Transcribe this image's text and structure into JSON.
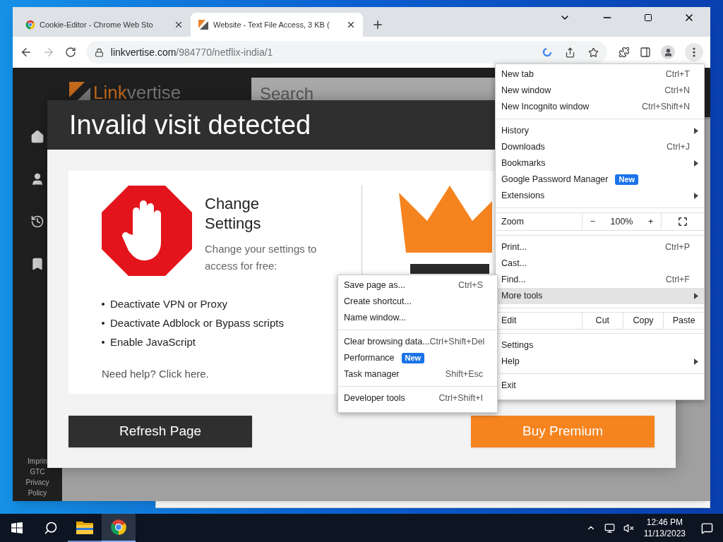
{
  "browser": {
    "tabs": [
      {
        "title": "Cookie-Editor - Chrome Web Sto",
        "selected": false
      },
      {
        "title": "Website - Text File Access, 3 KB (",
        "selected": true
      }
    ],
    "url_host": "linkvertise.com",
    "url_path": "/984770/netflix-india/1"
  },
  "site": {
    "logo_lead": "Link",
    "logo_rest": "vertise",
    "search_placeholder": "Search",
    "footer_links": [
      "Imprin",
      "GTC",
      "Privacy Policy"
    ]
  },
  "modal": {
    "title": "Invalid visit detected",
    "heading": "Change Settings",
    "subtext": "Change your settings to access for free:",
    "steps": [
      "Deactivate VPN or Proxy",
      "Deactivate Adblock or Bypass scripts",
      "Enable JavaScript"
    ],
    "help": "Need help? Click here.",
    "buttons": [
      {
        "label": "Refresh Page",
        "kind": "secondary"
      },
      {
        "label": "Buy Premium",
        "kind": "primary"
      }
    ]
  },
  "chrome_menu": {
    "sections": [
      [
        {
          "kind": "item",
          "label": "New tab",
          "shortcut": "Ctrl+T",
          "submenu": false,
          "selected": false
        },
        {
          "kind": "item",
          "label": "New window",
          "shortcut": "Ctrl+N",
          "submenu": false,
          "selected": false
        },
        {
          "kind": "item",
          "label": "New Incognito window",
          "shortcut": "Ctrl+Shift+N",
          "submenu": false,
          "selected": false
        }
      ],
      [
        {
          "kind": "item",
          "label": "History",
          "submenu": true,
          "selected": false
        },
        {
          "kind": "item",
          "label": "Downloads",
          "shortcut": "Ctrl+J",
          "submenu": false,
          "selected": false
        },
        {
          "kind": "item",
          "label": "Bookmarks",
          "submenu": true,
          "selected": false
        },
        {
          "kind": "item",
          "label": "Google Password Manager",
          "badge": "New",
          "submenu": false,
          "selected": false
        },
        {
          "kind": "item",
          "label": "Extensions",
          "submenu": true,
          "selected": false
        }
      ],
      [
        {
          "kind": "zoom",
          "label": "Zoom",
          "minus": "−",
          "value": "100%",
          "plus": "+"
        }
      ],
      [
        {
          "kind": "item",
          "label": "Print...",
          "shortcut": "Ctrl+P",
          "submenu": false,
          "selected": false
        },
        {
          "kind": "item",
          "label": "Cast...",
          "submenu": false,
          "selected": false
        },
        {
          "kind": "item",
          "label": "Find...",
          "shortcut": "Ctrl+F",
          "submenu": false,
          "selected": false
        },
        {
          "kind": "item",
          "label": "More tools",
          "submenu": true,
          "selected": true
        }
      ],
      [
        {
          "kind": "edit",
          "label": "Edit",
          "actions": [
            "Cut",
            "Copy",
            "Paste"
          ]
        }
      ],
      [
        {
          "kind": "item",
          "label": "Settings",
          "submenu": false,
          "selected": false
        },
        {
          "kind": "item",
          "label": "Help",
          "submenu": true,
          "selected": false
        }
      ],
      [
        {
          "kind": "item",
          "label": "Exit",
          "submenu": false,
          "selected": false
        }
      ]
    ]
  },
  "more_tools_menu": {
    "sections": [
      [
        {
          "kind": "item",
          "label": "Save page as...",
          "shortcut": "Ctrl+S",
          "submenu": false,
          "selected": false
        },
        {
          "kind": "item",
          "label": "Create shortcut...",
          "submenu": false,
          "selected": false
        },
        {
          "kind": "item",
          "label": "Name window...",
          "submenu": false,
          "selected": false
        }
      ],
      [
        {
          "kind": "item",
          "label": "Clear browsing data...",
          "shortcut": "Ctrl+Shift+Del",
          "submenu": false,
          "selected": false
        },
        {
          "kind": "item",
          "label": "Performance",
          "badge": "New",
          "submenu": false,
          "selected": false
        },
        {
          "kind": "item",
          "label": "Task manager",
          "shortcut": "Shift+Esc",
          "submenu": false,
          "selected": false
        }
      ],
      [
        {
          "kind": "item",
          "label": "Developer tools",
          "shortcut": "Ctrl+Shift+I",
          "submenu": false,
          "selected": false
        }
      ]
    ]
  },
  "taskbar": {
    "apps": [
      {
        "kind": "explorer",
        "selected": false
      },
      {
        "kind": "chrome",
        "selected": true
      }
    ],
    "time": "12:46 PM",
    "date": "11/13/2023"
  }
}
